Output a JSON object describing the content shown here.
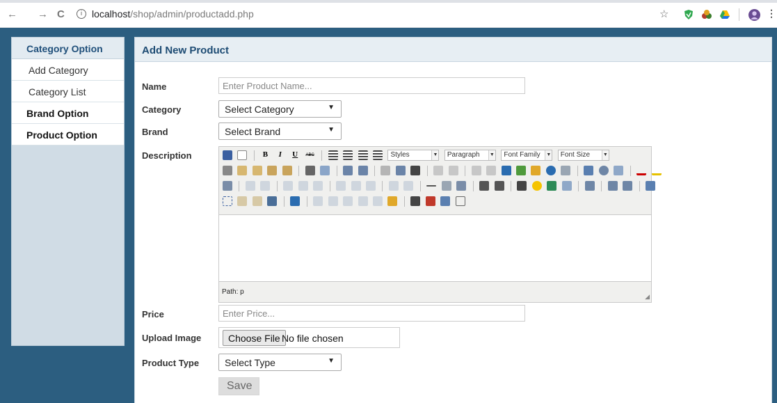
{
  "browser": {
    "back": "←",
    "forward": "→",
    "reload": "C",
    "info": "i",
    "url_host": "localhost",
    "url_path": "/shop/admin/productadd.php",
    "star": "☆",
    "menu": "⋮",
    "extension_icons": [
      "shield-extension-icon",
      "puzzle-extension-icon",
      "drive-extension-icon",
      "profile-avatar-icon"
    ],
    "extension_colors": [
      "#2fa84f",
      "#b33b2b",
      "#fbbc04",
      "#6a4c93"
    ]
  },
  "sidebar": {
    "category_header": "Category Option",
    "add_category": "Add Category",
    "category_list": "Category List",
    "brand_option": "Brand Option",
    "product_option": "Product Option"
  },
  "main": {
    "title": "Add New Product"
  },
  "form": {
    "name_label": "Name",
    "name_placeholder": "Enter Product Name...",
    "category_label": "Category",
    "category_value": "Select Category",
    "brand_label": "Brand",
    "brand_value": "Select Brand",
    "description_label": "Description",
    "price_label": "Price",
    "price_placeholder": "Enter Price...",
    "upload_label": "Upload Image",
    "file_button": "Choose File",
    "file_status": "No file chosen",
    "type_label": "Product Type",
    "type_value": "Select Type",
    "save_label": "Save",
    "select_arrow": "▼"
  },
  "editor": {
    "styles": "Styles",
    "paragraph": "Paragraph",
    "font_family": "Font Family",
    "font_size": "Font Size",
    "dropdown_arrow": "▼",
    "path": "Path: p",
    "resize_grip": "◢",
    "bold": "B",
    "italic": "I",
    "underline": "U",
    "strike": "ABC"
  },
  "colors": {
    "background": "#2c5e80",
    "sidebar": "#d0dce5",
    "header_text": "#1d4b73",
    "toolbar": "#f0f0ee"
  }
}
